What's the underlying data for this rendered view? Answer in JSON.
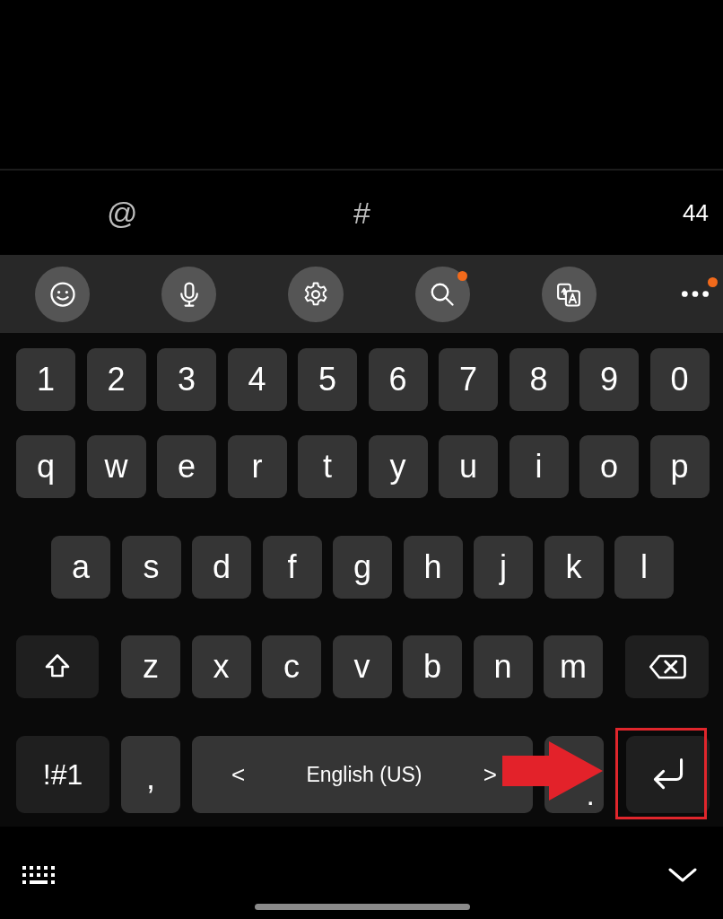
{
  "suggestions": [
    {
      "text": "@",
      "kind": "symbol"
    },
    {
      "text": "#",
      "kind": "symbol"
    },
    {
      "text": "44",
      "kind": "count"
    }
  ],
  "toolbar": [
    {
      "kind": "emoji",
      "badge": false
    },
    {
      "kind": "voice",
      "badge": false
    },
    {
      "kind": "settings",
      "badge": false
    },
    {
      "kind": "search",
      "badge": true
    },
    {
      "kind": "translate",
      "badge": false
    },
    {
      "kind": "more",
      "badge": true
    }
  ],
  "rows": [
    [
      {
        "label": "1",
        "kind": "char"
      },
      {
        "label": "2",
        "kind": "char"
      },
      {
        "label": "3",
        "kind": "char"
      },
      {
        "label": "4",
        "kind": "char"
      },
      {
        "label": "5",
        "kind": "char"
      },
      {
        "label": "6",
        "kind": "char"
      },
      {
        "label": "7",
        "kind": "char"
      },
      {
        "label": "8",
        "kind": "char"
      },
      {
        "label": "9",
        "kind": "char"
      },
      {
        "label": "0",
        "kind": "char"
      }
    ],
    [
      {
        "label": "q",
        "kind": "char"
      },
      {
        "label": "w",
        "kind": "char"
      },
      {
        "label": "e",
        "kind": "char"
      },
      {
        "label": "r",
        "kind": "char"
      },
      {
        "label": "t",
        "kind": "char"
      },
      {
        "label": "y",
        "kind": "char"
      },
      {
        "label": "u",
        "kind": "char"
      },
      {
        "label": "i",
        "kind": "char"
      },
      {
        "label": "o",
        "kind": "char"
      },
      {
        "label": "p",
        "kind": "char"
      }
    ],
    [
      {
        "label": "a",
        "kind": "char"
      },
      {
        "label": "s",
        "kind": "char"
      },
      {
        "label": "d",
        "kind": "char"
      },
      {
        "label": "f",
        "kind": "char"
      },
      {
        "label": "g",
        "kind": "char"
      },
      {
        "label": "h",
        "kind": "char"
      },
      {
        "label": "j",
        "kind": "char"
      },
      {
        "label": "k",
        "kind": "char"
      },
      {
        "label": "l",
        "kind": "char"
      }
    ],
    [
      {
        "kind": "shift"
      },
      {
        "label": "z",
        "kind": "char"
      },
      {
        "label": "x",
        "kind": "char"
      },
      {
        "label": "c",
        "kind": "char"
      },
      {
        "label": "v",
        "kind": "char"
      },
      {
        "label": "b",
        "kind": "char"
      },
      {
        "label": "n",
        "kind": "char"
      },
      {
        "label": "m",
        "kind": "char"
      },
      {
        "kind": "backspace"
      }
    ],
    [
      {
        "label": "!#1",
        "kind": "symbols"
      },
      {
        "label": ",",
        "kind": "char"
      },
      {
        "label": "English (US)",
        "kind": "space",
        "prev": "<",
        "next": ">"
      },
      {
        "label": ".",
        "kind": "char"
      },
      {
        "kind": "enter"
      }
    ]
  ],
  "annotations": {
    "arrow": true,
    "highlight_box": true
  }
}
